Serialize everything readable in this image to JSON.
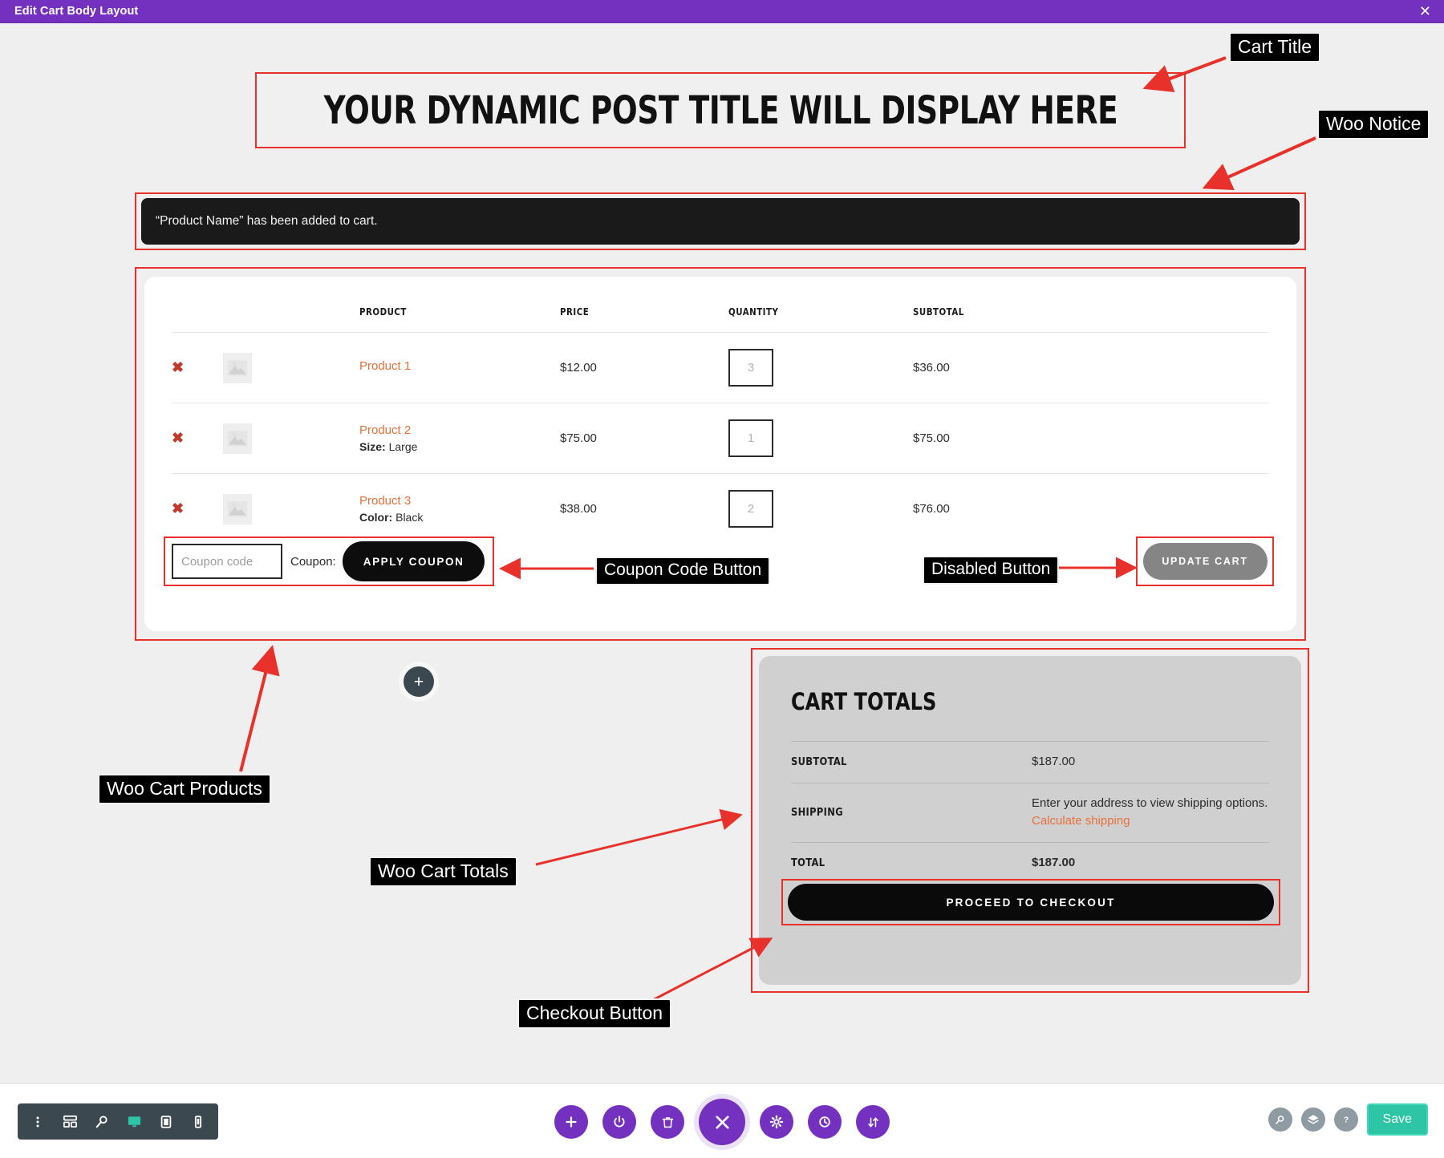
{
  "topbar": {
    "title": "Edit Cart Body Layout",
    "close_icon": "close-icon",
    "close_glyph": "✕"
  },
  "cart": {
    "title": "YOUR DYNAMIC POST TITLE WILL DISPLAY HERE",
    "notice": "“Product Name” has been added to cart.",
    "table": {
      "headers": [
        "PRODUCT",
        "PRICE",
        "QUANTITY",
        "SUBTOTAL"
      ],
      "rows": [
        {
          "remove": "✖",
          "name": "Product 1",
          "meta_label": "",
          "meta_value": "",
          "price": "$12.00",
          "qty": "3",
          "subtotal": "$36.00"
        },
        {
          "remove": "✖",
          "name": "Product 2",
          "meta_label": "Size:",
          "meta_value": "Large",
          "price": "$75.00",
          "qty": "1",
          "subtotal": "$75.00"
        },
        {
          "remove": "✖",
          "name": "Product 3",
          "meta_label": "Color:",
          "meta_value": "Black",
          "price": "$38.00",
          "qty": "2",
          "subtotal": "$76.00"
        }
      ]
    },
    "coupon": {
      "placeholder": "Coupon code",
      "value": "",
      "label": "Coupon:",
      "apply_label": "APPLY COUPON"
    },
    "update_cart_label": "UPDATE CART"
  },
  "totals": {
    "heading": "CART TOTALS",
    "rows": [
      {
        "key": "SUBTOTAL",
        "value": "$187.00",
        "bold": false
      },
      {
        "key": "SHIPPING",
        "value": "Enter your address to view shipping options.",
        "link": "Calculate shipping",
        "bold": false
      },
      {
        "key": "TOTAL",
        "value": "$187.00",
        "bold": true
      }
    ],
    "checkout_label": "PROCEED TO CHECKOUT"
  },
  "annotations": [
    {
      "id": "cart-title",
      "label": "Cart Title"
    },
    {
      "id": "woo-notice",
      "label": "Woo Notice"
    },
    {
      "id": "coupon-code-button",
      "label": "Coupon Code Button"
    },
    {
      "id": "disabled-button",
      "label": "Disabled Button"
    },
    {
      "id": "woo-cart-products",
      "label": "Woo Cart Products"
    },
    {
      "id": "woo-cart-totals",
      "label": "Woo Cart Totals"
    },
    {
      "id": "checkout-button",
      "label": "Checkout Button"
    }
  ],
  "add_module": {
    "glyph": "+"
  },
  "bottombar": {
    "left_icons": [
      "more-vertical-icon",
      "wireframe-icon",
      "search-icon",
      "desktop-icon",
      "tablet-icon",
      "phone-icon"
    ],
    "center_icons": [
      "add-icon",
      "power-icon",
      "trash-icon",
      "close-icon",
      "settings-icon",
      "history-icon",
      "sort-icon"
    ],
    "right_icons": [
      "zoom-icon",
      "layers-icon",
      "help-icon"
    ],
    "save_label": "Save"
  },
  "colors": {
    "brand_purple": "#7431c0",
    "accent_orange": "#e8703a",
    "annotation_red": "#e8312a",
    "save_green": "#2ec4a6",
    "dark": "#1a1a1a"
  }
}
